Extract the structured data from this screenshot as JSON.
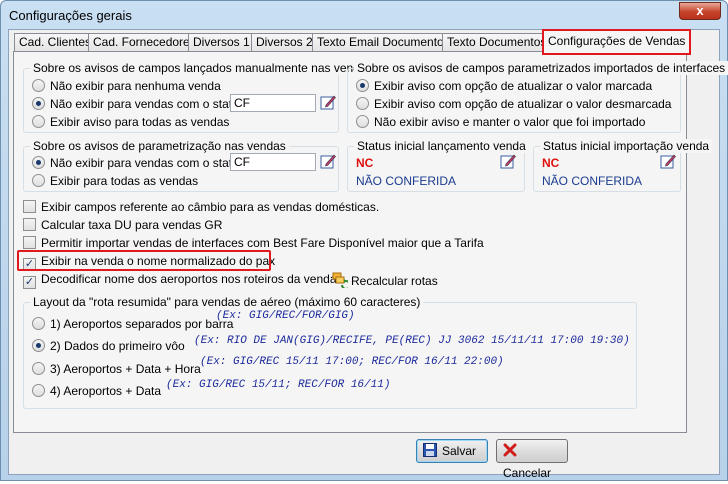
{
  "window": {
    "title": "Configurações gerais",
    "close_glyph": "x"
  },
  "tabs": [
    {
      "label": "Cad. Clientes",
      "active": false
    },
    {
      "label": "Cad. Fornecedores",
      "active": false
    },
    {
      "label": "Diversos 1",
      "active": false
    },
    {
      "label": "Diversos 2",
      "active": false
    },
    {
      "label": "Texto Email Documentos",
      "active": false
    },
    {
      "label": "Texto Documentos",
      "active": false
    },
    {
      "label": "Configurações de Vendas",
      "active": true
    }
  ],
  "group_manual": {
    "title": "Sobre os avisos de campos lançados manualmente nas vendas",
    "options": [
      {
        "label": "Não exibir para nenhuma venda",
        "checked": false
      },
      {
        "label": "Não exibir para vendas com o status",
        "checked": true
      },
      {
        "label": "Exibir aviso para todas as vendas",
        "checked": false
      }
    ],
    "status_value": "CF"
  },
  "group_interfaces": {
    "title": "Sobre os avisos de campos parametrizados importados de interfaces",
    "options": [
      {
        "label": "Exibir aviso com opção de atualizar o valor marcada",
        "checked": true
      },
      {
        "label": "Exibir aviso com opção de atualizar o valor desmarcada",
        "checked": false
      },
      {
        "label": "Não exibir aviso e manter o valor que foi importado",
        "checked": false
      }
    ]
  },
  "group_param": {
    "title": "Sobre os avisos de parametrização nas vendas",
    "options": [
      {
        "label": "Não exibir para vendas com o status",
        "checked": true
      },
      {
        "label": "Exibir para todas as vendas",
        "checked": false
      }
    ],
    "status_value": "CF"
  },
  "group_status_launch": {
    "title": "Status inicial lançamento venda",
    "code": "NC",
    "description": "NÃO CONFERIDA"
  },
  "group_status_import": {
    "title": "Status inicial importação venda",
    "code": "NC",
    "description": "NÃO CONFERIDA"
  },
  "checkboxes": [
    {
      "label": "Exibir campos referente ao câmbio para as vendas domésticas.",
      "checked": false
    },
    {
      "label": "Calcular taxa DU para vendas GR",
      "checked": false
    },
    {
      "label": "Permitir importar vendas de interfaces com Best Fare Disponível maior que a Tarifa",
      "checked": false
    },
    {
      "label": "Exibir na venda o nome normalizado do pax",
      "checked": true
    },
    {
      "label": "Decodificar nome dos aeroportos nos roteiros da venda.",
      "checked": true
    }
  ],
  "recalc_button": {
    "label": "Recalcular rotas",
    "icon": "route-refresh-icon"
  },
  "group_layout": {
    "title": "Layout da \"rota resumida\" para vendas de aéreo (máximo 60 caracteres)",
    "options": [
      {
        "label": "1) Aeroportos separados por barra",
        "checked": false,
        "example": "(Ex: GIG/REC/FOR/GIG)"
      },
      {
        "label": "2) Dados do primeiro vôo",
        "checked": true,
        "example": "(Ex: RIO DE JAN(GIG)/RECIFE, PE(REC) JJ 3062 15/11/11 17:00 19:30)"
      },
      {
        "label": "3) Aeroportos + Data + Hora",
        "checked": false,
        "example": "(Ex: GIG/REC 15/11 17:00; REC/FOR 16/11 22:00)"
      },
      {
        "label": "4) Aeroportos + Data",
        "checked": false,
        "example": "(Ex: GIG/REC 15/11; REC/FOR 16/11)"
      }
    ]
  },
  "footer": {
    "save_label": "Salvar",
    "cancel_label": "Cancelar"
  },
  "colors": {
    "highlight": "#e0191f",
    "status_code": "#e01010",
    "status_text": "#1a3c8f",
    "example_text": "#1c2a9b"
  }
}
